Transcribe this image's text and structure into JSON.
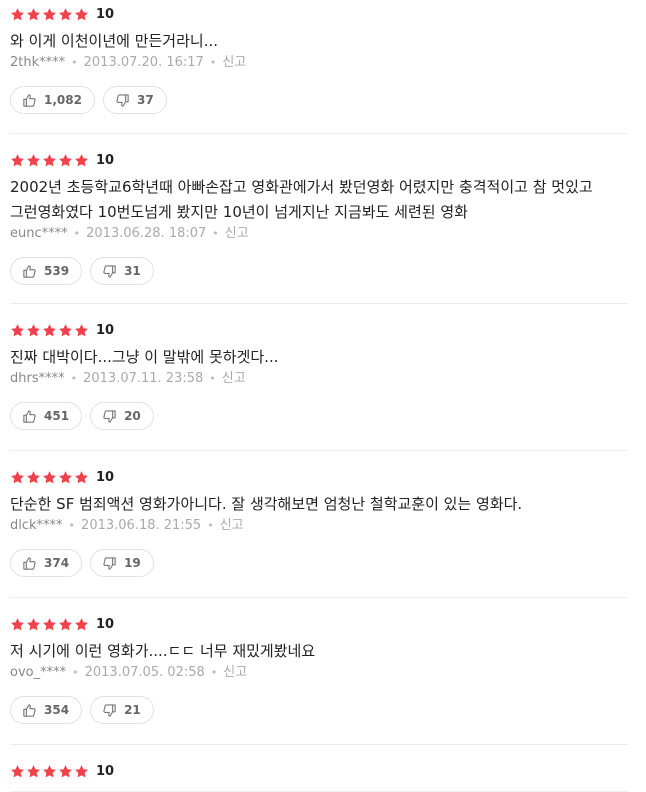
{
  "accent": {
    "star_color": "#f0424d",
    "text": "#222222",
    "muted": "#888888"
  },
  "icons": {
    "star": "star-icon",
    "like": "thumbs-up-icon",
    "dislike": "thumbs-down-icon"
  },
  "report_label": "신고",
  "reviews": [
    {
      "score": "10",
      "comment": "와 이게 이천이년에 만든거라니...",
      "author": "2thk****",
      "date": "2013.07.20. 16:17",
      "likes": "1,082",
      "dislikes": "37"
    },
    {
      "score": "10",
      "comment": "2002년 초등학교6학년때 아빠손잡고 영화관에가서 봤던영화 어렸지만 충격적이고 참 멋있고 그런영화였다 10번도넘게 봤지만 10년이 넘게지난 지금봐도 세련된 영화",
      "author": "eunc****",
      "date": "2013.06.28. 18:07",
      "likes": "539",
      "dislikes": "31"
    },
    {
      "score": "10",
      "comment": "진짜 대박이다...그냥 이 말밖에 못하겟다...",
      "author": "dhrs****",
      "date": "2013.07.11. 23:58",
      "likes": "451",
      "dislikes": "20"
    },
    {
      "score": "10",
      "comment": "단순한 SF 범죄액션 영화가아니다. 잘 생각해보면 엄청난 철학교훈이 있는 영화다.",
      "author": "dlck****",
      "date": "2013.06.18. 21:55",
      "likes": "374",
      "dislikes": "19"
    },
    {
      "score": "10",
      "comment": "저 시기에 이런 영화가....ㄷㄷ 너무 재밌게봤네요",
      "author": "ovo_****",
      "date": "2013.07.05. 02:58",
      "likes": "354",
      "dislikes": "21"
    },
    {
      "score": "10"
    }
  ]
}
